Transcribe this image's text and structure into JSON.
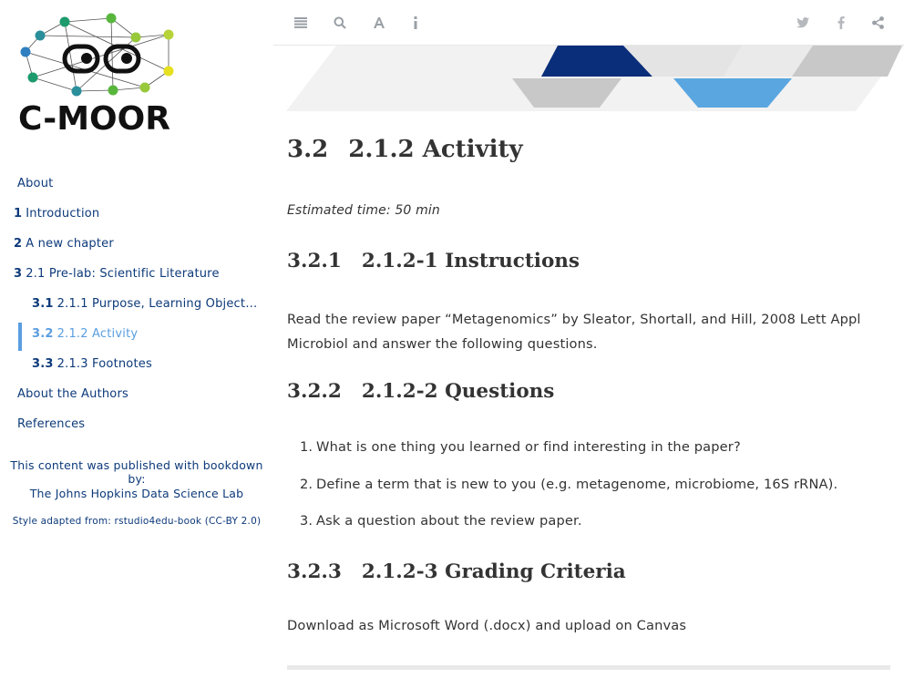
{
  "logo": {
    "text": "C-MOOR"
  },
  "sidebar": {
    "items": [
      {
        "num": "",
        "label": "About",
        "level": 1,
        "active": false
      },
      {
        "num": "1",
        "label": "Introduction",
        "level": 1,
        "active": false
      },
      {
        "num": "2",
        "label": "A new chapter",
        "level": 1,
        "active": false
      },
      {
        "num": "3",
        "label": "2.1 Pre-lab: Scientific Literature",
        "level": 1,
        "active": false
      },
      {
        "num": "3.1",
        "label": "2.1.1 Purpose, Learning Objectives …",
        "level": 2,
        "active": false
      },
      {
        "num": "3.2",
        "label": "2.1.2 Activity",
        "level": 2,
        "active": true
      },
      {
        "num": "3.3",
        "label": "2.1.3 Footnotes",
        "level": 2,
        "active": false
      },
      {
        "num": "",
        "label": "About the Authors",
        "level": 1,
        "active": false
      },
      {
        "num": "",
        "label": "References",
        "level": 1,
        "active": false
      }
    ],
    "credit_line1": "This content was published with bookdown by:",
    "credit_line2": "The Johns Hopkins Data Science Lab",
    "credit_line3": "Style adapted from: rstudio4edu-book (CC-BY 2.0)"
  },
  "toolbar": {
    "left_icons": [
      "toc-toggle-icon",
      "search-icon",
      "font-settings-icon",
      "info-icon"
    ],
    "right_icons": [
      "twitter-icon",
      "facebook-icon",
      "share-icon"
    ]
  },
  "main": {
    "title_num": "3.2",
    "title": "2.1.2 Activity",
    "estimated_time": "Estimated time: 50 min",
    "sections": [
      {
        "num": "3.2.1",
        "title": "2.1.2-1 Instructions"
      },
      {
        "num": "3.2.2",
        "title": "2.1.2-2 Questions"
      },
      {
        "num": "3.2.3",
        "title": "2.1.2-3 Grading Criteria"
      }
    ],
    "instructions": "Read the review paper “Metagenomics” by Sleator, Shortall, and Hill, 2008 Lett Appl Microbiol and answer the following questions.",
    "questions": [
      "What is one thing you learned or find interesting in the paper?",
      "Define a term that is new to you (e.g. metagenome, microbiome, 16S rRNA).",
      "Ask a question about the review paper."
    ],
    "grading": "Download as Microsoft Word (.docx) and upload on Canvas"
  },
  "colors": {
    "link": "#0d3a7a",
    "active": "#5a9ee0",
    "navy": "#0a2e7a",
    "sky": "#5aa6e0",
    "grey": "#c8c8c8"
  }
}
